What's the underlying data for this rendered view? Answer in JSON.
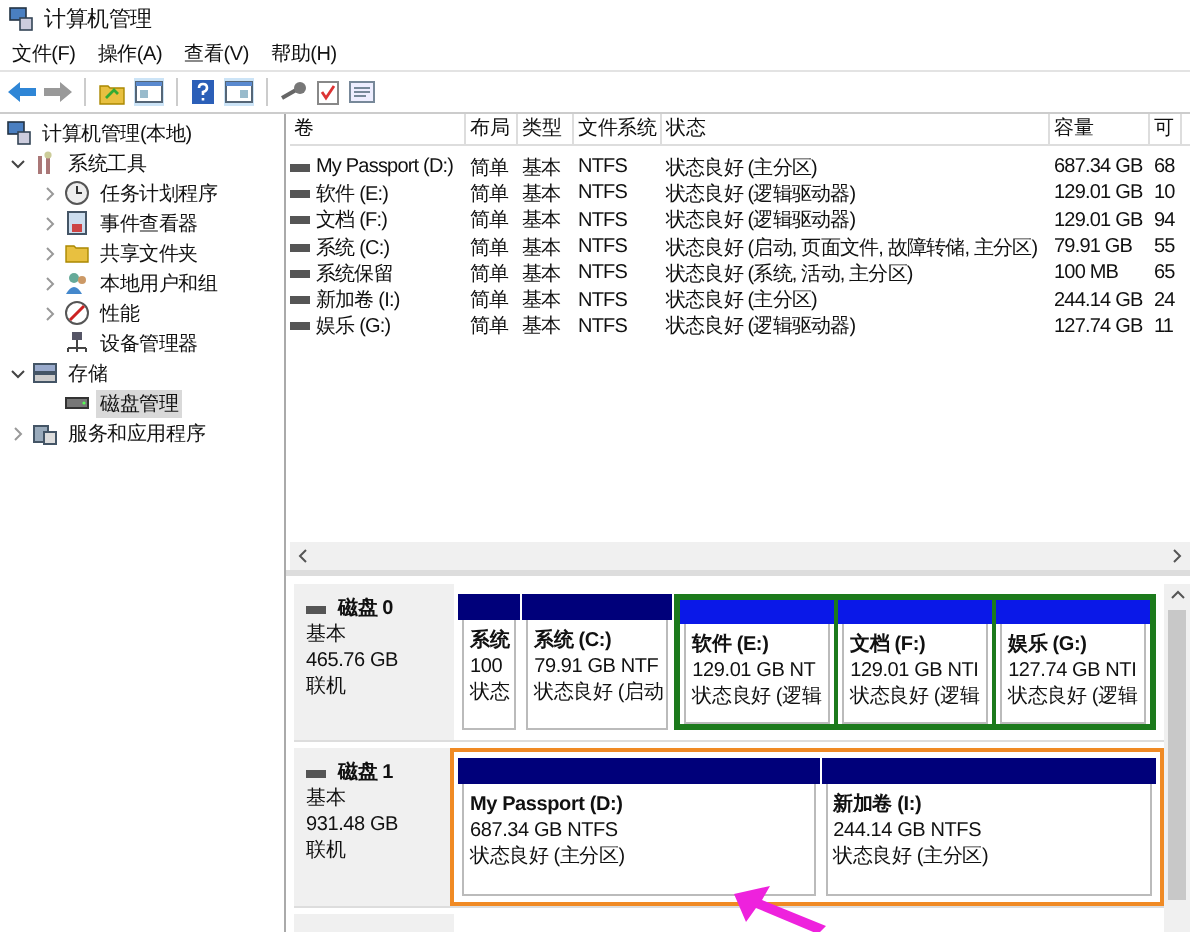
{
  "window": {
    "title": "计算机管理"
  },
  "menu": [
    "文件(F)",
    "操作(A)",
    "查看(V)",
    "帮助(H)"
  ],
  "tree": [
    {
      "label": "计算机管理(本地)",
      "selected": false,
      "children": [
        {
          "label": "系统工具",
          "expanded": true,
          "selected": false,
          "children": [
            {
              "label": "任务计划程序",
              "expanded": false,
              "selected": false
            },
            {
              "label": "事件查看器",
              "expanded": false,
              "selected": false
            },
            {
              "label": "共享文件夹",
              "expanded": false,
              "selected": false
            },
            {
              "label": "本地用户和组",
              "expanded": false,
              "selected": false
            },
            {
              "label": "性能",
              "expanded": false,
              "selected": false
            },
            {
              "label": "设备管理器",
              "selected": false
            }
          ]
        },
        {
          "label": "存储",
          "expanded": true,
          "selected": false,
          "children": [
            {
              "label": "磁盘管理",
              "selected": true
            }
          ]
        },
        {
          "label": "服务和应用程序",
          "expanded": false,
          "selected": false
        }
      ]
    }
  ],
  "table": {
    "columns": [
      "卷",
      "布局",
      "类型",
      "文件系统",
      "状态",
      "容量",
      "可"
    ],
    "rows": [
      [
        "My Passport (D:)",
        "简单",
        "基本",
        "NTFS",
        "状态良好 (主分区)",
        "687.34 GB",
        "68"
      ],
      [
        "软件 (E:)",
        "简单",
        "基本",
        "NTFS",
        "状态良好 (逻辑驱动器)",
        "129.01 GB",
        "10"
      ],
      [
        "文档 (F:)",
        "简单",
        "基本",
        "NTFS",
        "状态良好 (逻辑驱动器)",
        "129.01 GB",
        "94"
      ],
      [
        "系统 (C:)",
        "简单",
        "基本",
        "NTFS",
        "状态良好 (启动, 页面文件, 故障转储, 主分区)",
        "79.91 GB",
        "55"
      ],
      [
        "系统保留",
        "简单",
        "基本",
        "NTFS",
        "状态良好 (系统, 活动, 主分区)",
        "100 MB",
        "65"
      ],
      [
        "新加卷 (I:)",
        "简单",
        "基本",
        "NTFS",
        "状态良好 (主分区)",
        "244.14 GB",
        "24"
      ],
      [
        "娱乐 (G:)",
        "简单",
        "基本",
        "NTFS",
        "状态良好 (逻辑驱动器)",
        "127.74 GB",
        "11"
      ]
    ]
  },
  "disks": [
    {
      "name": "磁盘 0",
      "type": "基本",
      "size": "465.76 GB",
      "status": "联机",
      "highlighted": false,
      "partitions": [
        {
          "kind": "primary",
          "lines": [
            "系统",
            "100",
            "状态"
          ]
        },
        {
          "kind": "primary",
          "lines": [
            "系统  (C:)",
            "79.91 GB NTF",
            "状态良好 (启动"
          ]
        },
        {
          "kind": "logical",
          "lines": [
            "软件  (E:)",
            "129.01 GB NT",
            "状态良好 (逻辑"
          ]
        },
        {
          "kind": "logical",
          "lines": [
            "文档  (F:)",
            "129.01 GB NTI",
            "状态良好 (逻辑"
          ]
        },
        {
          "kind": "logical",
          "lines": [
            "娱乐  (G:)",
            "127.74 GB NTI",
            "状态良好 (逻辑"
          ]
        }
      ]
    },
    {
      "name": "磁盘 1",
      "type": "基本",
      "size": "931.48 GB",
      "status": "联机",
      "highlighted": true,
      "partitions": [
        {
          "kind": "primary",
          "lines": [
            "My Passport  (D:)",
            "687.34 GB NTFS",
            "状态良好 (主分区)"
          ]
        },
        {
          "kind": "primary",
          "lines": [
            "新加卷  (I:)",
            "244.14 GB NTFS",
            "状态良好 (主分区)"
          ]
        }
      ]
    }
  ]
}
